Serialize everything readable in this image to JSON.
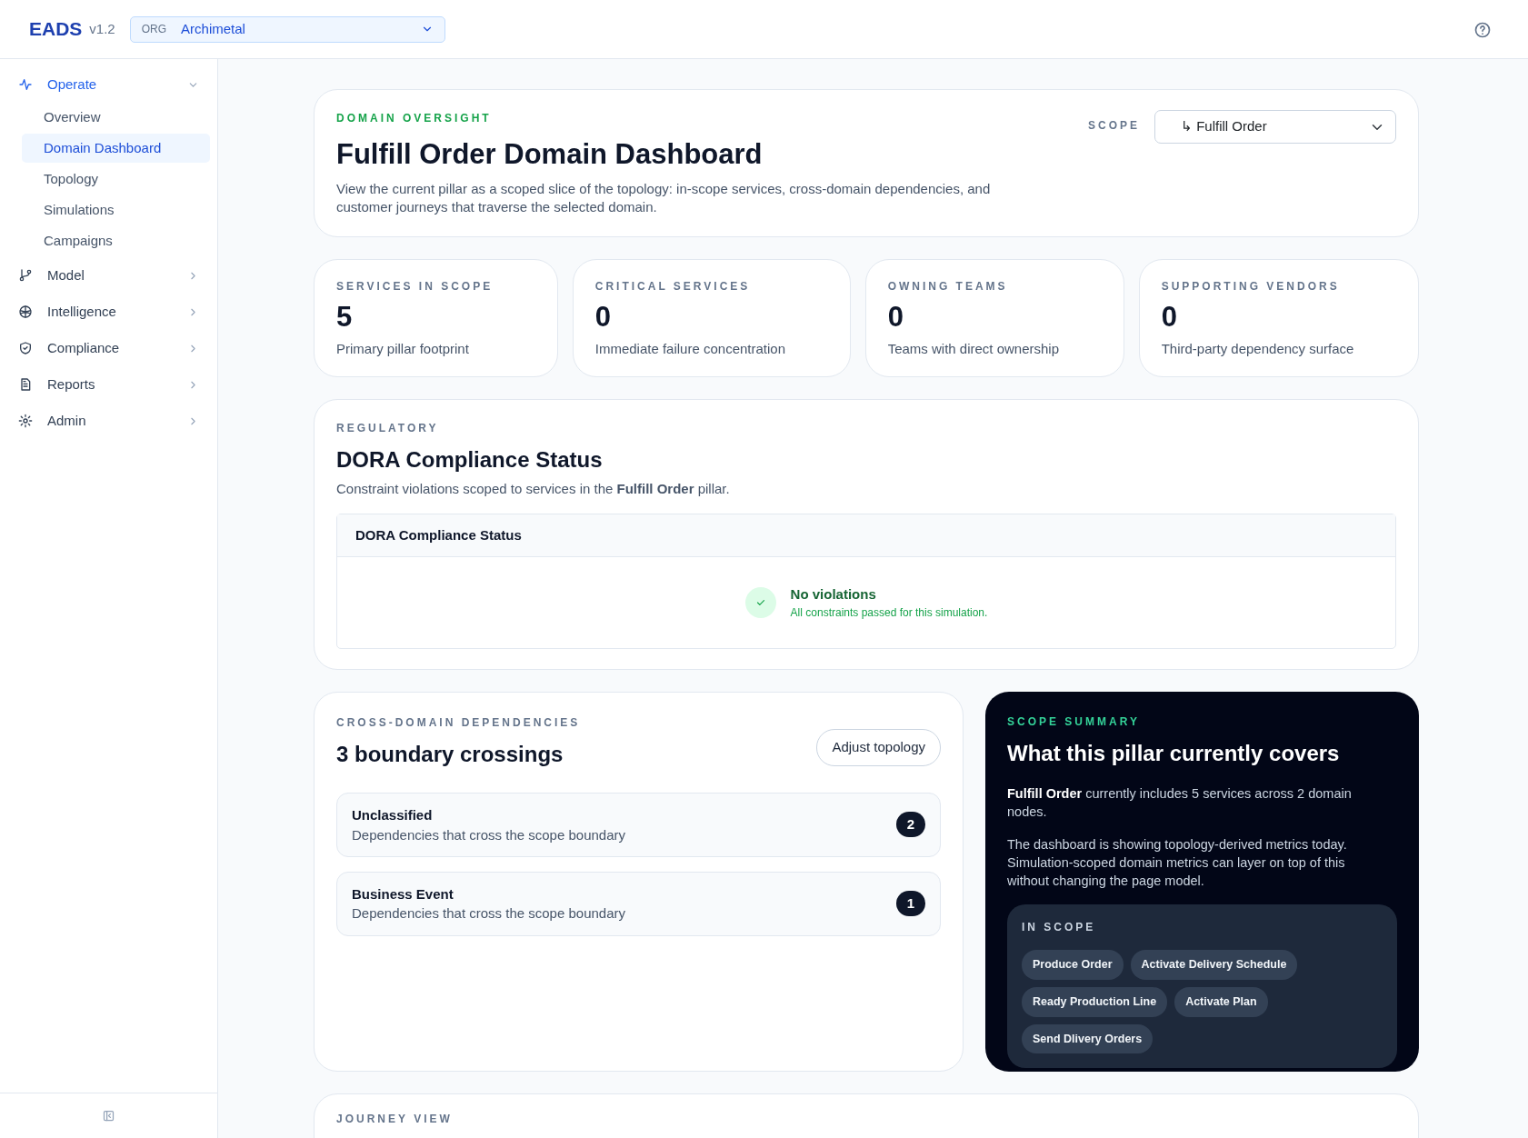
{
  "header": {
    "brand": "EADS",
    "version": "v1.2",
    "org_label": "ORG",
    "org_value": "Archimetal"
  },
  "sidebar": {
    "groups": [
      {
        "label": "Operate",
        "expanded": true,
        "children": [
          {
            "label": "Overview",
            "selected": false
          },
          {
            "label": "Domain Dashboard",
            "selected": true
          },
          {
            "label": "Topology",
            "selected": false
          },
          {
            "label": "Simulations",
            "selected": false
          },
          {
            "label": "Campaigns",
            "selected": false
          }
        ]
      },
      {
        "label": "Model",
        "expanded": false
      },
      {
        "label": "Intelligence",
        "expanded": false
      },
      {
        "label": "Compliance",
        "expanded": false
      },
      {
        "label": "Reports",
        "expanded": false
      },
      {
        "label": "Admin",
        "expanded": false
      }
    ]
  },
  "overview": {
    "eyebrow": "DOMAIN OVERSIGHT",
    "title": "Fulfill Order Domain Dashboard",
    "description": "View the current pillar as a scoped slice of the topology: in-scope services, cross-domain dependencies, and customer journeys that traverse the selected domain.",
    "scope_label": "SCOPE",
    "scope_value": "↳ Fulfill Order"
  },
  "stats": [
    {
      "label": "SERVICES IN SCOPE",
      "value": "5",
      "caption": "Primary pillar footprint"
    },
    {
      "label": "CRITICAL SERVICES",
      "value": "0",
      "caption": "Immediate failure concentration"
    },
    {
      "label": "OWNING TEAMS",
      "value": "0",
      "caption": "Teams with direct ownership"
    },
    {
      "label": "SUPPORTING VENDORS",
      "value": "0",
      "caption": "Third-party dependency surface"
    }
  ],
  "regulatory": {
    "eyebrow": "REGULATORY",
    "title": "DORA Compliance Status",
    "description": "Constraint violations scoped to services in the **Fulfill Order** pillar.",
    "panel_title": "DORA Compliance Status",
    "status_title": "No violations",
    "status_detail": "All constraints passed for this simulation."
  },
  "dependencies": {
    "eyebrow": "CROSS-DOMAIN DEPENDENCIES",
    "title": "3 boundary crossings",
    "button": "Adjust topology",
    "items": [
      {
        "label": "Unclassified",
        "description": "Dependencies that cross the scope boundary",
        "count": "2"
      },
      {
        "label": "Business Event",
        "description": "Dependencies that cross the scope boundary",
        "count": "1"
      }
    ]
  },
  "scope_summary": {
    "eyebrow": "SCOPE SUMMARY",
    "title": "What this pillar currently covers",
    "paragraphs": [
      "**Fulfill Order** currently includes 5 services across 2 domain nodes.",
      "The dashboard is showing topology-derived metrics today. Simulation-scoped domain metrics can layer on top of this without changing the page model."
    ],
    "in_scope_label": "IN SCOPE",
    "tags": [
      "Produce Order",
      "Activate Delivery Schedule",
      "Ready Production Line",
      "Activate Plan",
      "Send Dlivery Orders"
    ]
  },
  "journey": {
    "eyebrow": "JOURNEY VIEW"
  }
}
